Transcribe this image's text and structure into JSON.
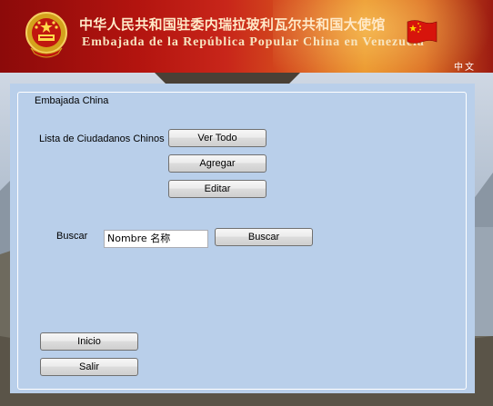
{
  "header": {
    "title_cn": "中华人民共和国驻委内瑞拉玻利瓦尔共和国大使馆",
    "title_es": "Embajada de la República Popular China en Venezuela",
    "language_link": "中文"
  },
  "form": {
    "group_title": "Embajada China",
    "citizens_label": "Lista de Ciudadanos Chinos",
    "view_all_button": "Ver Todo",
    "add_button": "Agregar",
    "edit_button": "Editar",
    "search_label": "Buscar",
    "search_value": "Nombre 名称",
    "search_button": "Buscar",
    "home_button": "Inicio",
    "exit_button": "Salir"
  }
}
